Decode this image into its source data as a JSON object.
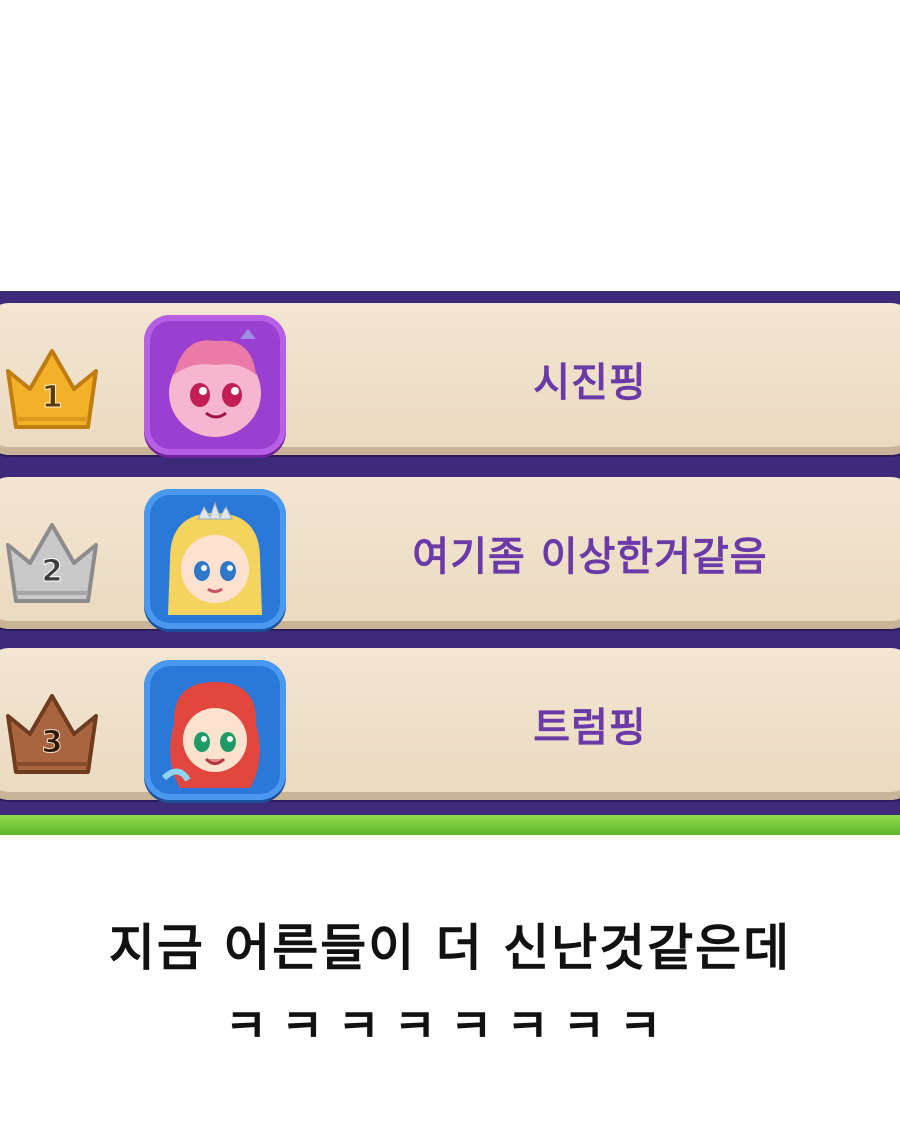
{
  "ranking": [
    {
      "rank": "1",
      "name": "시진핑",
      "crown_color": "#f3b12a",
      "frame_color": "#9a3fd0",
      "avatar_icon": "pink-character-avatar"
    },
    {
      "rank": "2",
      "name": "여기좀 이상한거같음",
      "crown_color": "#b9b9b9",
      "frame_color": "#2a79d9",
      "avatar_icon": "blonde-princess-avatar"
    },
    {
      "rank": "3",
      "name": "트럼핑",
      "crown_color": "#a9653f",
      "frame_color": "#2a79d9",
      "avatar_icon": "red-mermaid-avatar"
    }
  ],
  "caption": {
    "line1": "지금 어른들이 더 신난것같은데",
    "line2": "ㅋㅋㅋㅋㅋㅋㅋㅋ"
  }
}
